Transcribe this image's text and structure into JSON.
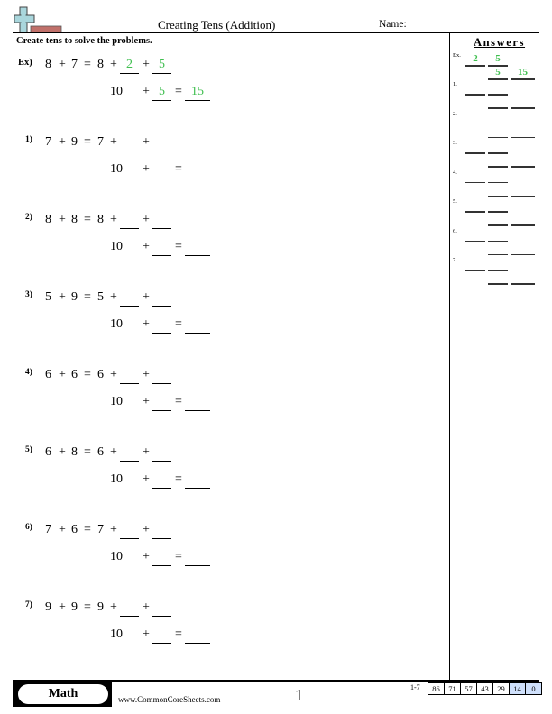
{
  "header": {
    "title": "Creating Tens (Addition)",
    "name_label": "Name:",
    "logo_icon": "plus-and-minus-logo-icon"
  },
  "instructions": "Create tens to solve the problems.",
  "example": {
    "label": "Ex)",
    "a": "8",
    "op": "+",
    "b": "7",
    "eq": "=",
    "first": "8",
    "fill1": "2",
    "fill2": "5",
    "ten": "10",
    "fill3": "5",
    "total": "15"
  },
  "problems": [
    {
      "label": "1)",
      "a": "7",
      "b": "9"
    },
    {
      "label": "2)",
      "a": "8",
      "b": "8"
    },
    {
      "label": "3)",
      "a": "5",
      "b": "9"
    },
    {
      "label": "4)",
      "a": "6",
      "b": "6"
    },
    {
      "label": "5)",
      "a": "6",
      "b": "8"
    },
    {
      "label": "6)",
      "a": "7",
      "b": "6"
    },
    {
      "label": "7)",
      "a": "9",
      "b": "9"
    }
  ],
  "symbols": {
    "plus": "+",
    "equals": "=",
    "ten": "10"
  },
  "answer_key": {
    "title": "Answers",
    "example_label": "Ex.",
    "example": [
      "2",
      "5",
      "5",
      "15"
    ],
    "labels": [
      "1.",
      "2.",
      "3.",
      "4.",
      "5.",
      "6.",
      "7."
    ]
  },
  "footer": {
    "subject": "Math",
    "site": "www.CommonCoreSheets.com",
    "page": "1",
    "score_range": "1-7",
    "scores": [
      "86",
      "71",
      "57",
      "43",
      "29",
      "14",
      "0"
    ],
    "highlight_color": "#cfe0fb"
  },
  "colors": {
    "answer_green": "#3fbf4f"
  }
}
